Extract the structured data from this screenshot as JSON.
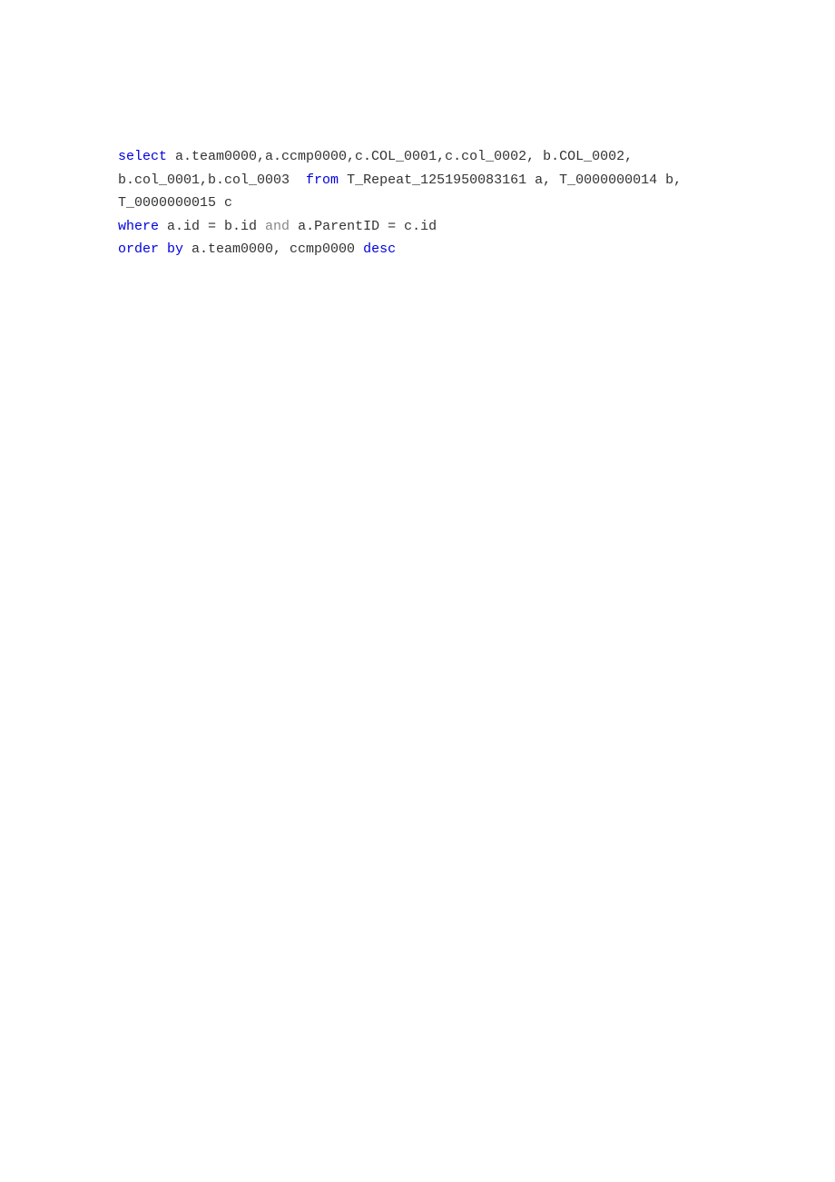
{
  "sql": {
    "tokens": [
      {
        "type": "keyword",
        "text": "select"
      },
      {
        "type": "text",
        "text": " a.team0000,a.ccmp0000,c.COL_0001,c.col_0002, b.COL_0002,\nb.col_0001,b.col_0003  "
      },
      {
        "type": "keyword",
        "text": "from"
      },
      {
        "type": "text",
        "text": " T_Repeat_1251950083161 a, T_0000000014 b,\nT_0000000015 c\n"
      },
      {
        "type": "keyword",
        "text": "where"
      },
      {
        "type": "text",
        "text": " a.id = b.id "
      },
      {
        "type": "keyword-and",
        "text": "and"
      },
      {
        "type": "text",
        "text": " a.ParentID = c.id\n"
      },
      {
        "type": "keyword",
        "text": "order by"
      },
      {
        "type": "text",
        "text": " a.team0000, ccmp0000 "
      },
      {
        "type": "keyword",
        "text": "desc"
      }
    ]
  }
}
